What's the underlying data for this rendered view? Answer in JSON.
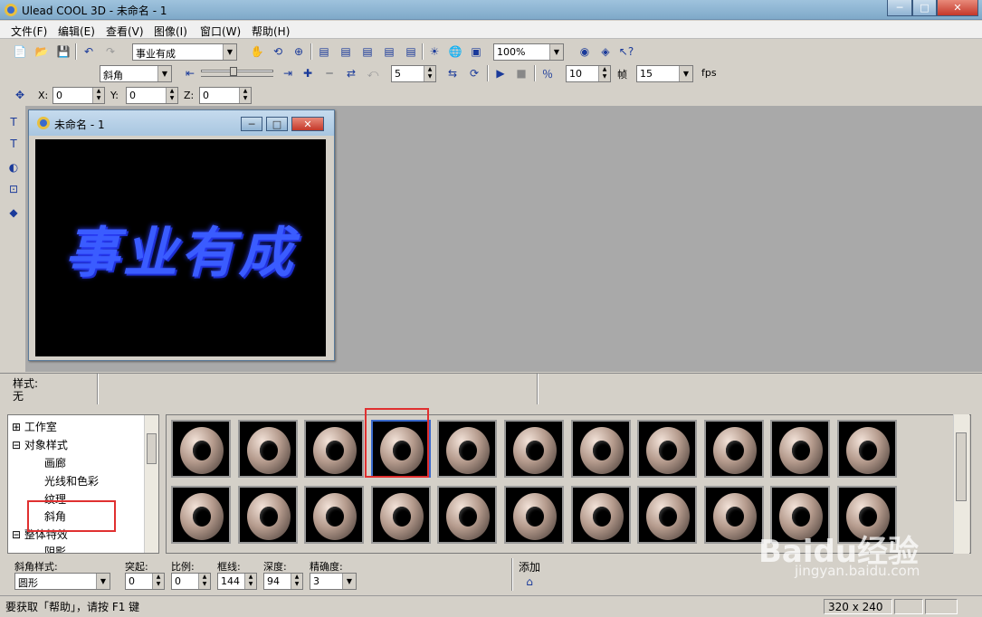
{
  "window": {
    "title": "Ulead COOL 3D - 未命名 - 1",
    "buttons": {
      "minimize": "─",
      "maximize": "□",
      "close": "✕"
    }
  },
  "menu": [
    "文件(F)",
    "编辑(E)",
    "查看(V)",
    "图像(I)",
    "窗口(W)",
    "帮助(H)"
  ],
  "toolbar1": {
    "text_combo": "事业有成",
    "zoom_combo": "100%"
  },
  "toolbar2": {
    "effect_combo": "斜角",
    "frame_value": "5",
    "frame_count": "10",
    "frame_label": "帧",
    "fps_value": "15",
    "fps_label": "fps"
  },
  "toolbar3": {
    "x_label": "X:",
    "x_value": "0",
    "y_label": "Y:",
    "y_value": "0",
    "z_label": "Z:",
    "z_value": "0"
  },
  "document": {
    "title": "未命名 - 1",
    "canvas_text": "事业有成",
    "canvas_color": "#3a5cff"
  },
  "style_info": {
    "label": "样式:",
    "value": "无"
  },
  "tree": [
    {
      "label": "工作室",
      "prefix": "⊞"
    },
    {
      "label": "对象样式",
      "prefix": "⊟"
    },
    {
      "label": "画廊"
    },
    {
      "label": "光线和色彩"
    },
    {
      "label": "纹理"
    },
    {
      "label": "斜角"
    },
    {
      "label": "整体特效",
      "prefix": "⊟"
    },
    {
      "label": "阴影"
    }
  ],
  "gallery": {
    "rows": 2,
    "cols": 11,
    "selected_index": 3
  },
  "bevel": {
    "style_label": "斜角样式:",
    "style_value": "圆形",
    "protrude_label": "突起:",
    "protrude_value": "0",
    "ratio_label": "比例:",
    "ratio_value": "0",
    "frame_label": "框线:",
    "frame_value": "144",
    "depth_label": "深度:",
    "depth_value": "94",
    "precision_label": "精确度:",
    "precision_value": "3",
    "add_label": "添加"
  },
  "status": {
    "help_text": "要获取「帮助」，请按 F1 键",
    "size": "320 x 240"
  },
  "watermark": {
    "brand": "Baidu经验",
    "url": "jingyan.baidu.com"
  }
}
